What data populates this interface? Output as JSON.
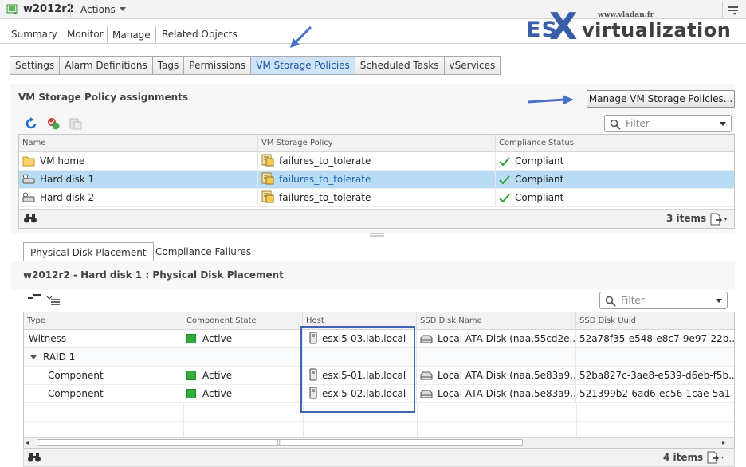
{
  "header": {
    "vm_name": "w2012r2",
    "actions_label": "Actions"
  },
  "logo": {
    "site": "www.vladan.fr",
    "es": "ES",
    "x": "X",
    "rest": "virtualization"
  },
  "main_tabs": [
    "Summary",
    "Monitor",
    "Manage",
    "Related Objects"
  ],
  "sub_tabs": [
    "Settings",
    "Alarm Definitions",
    "Tags",
    "Permissions",
    "VM Storage Policies",
    "Scheduled Tasks",
    "vServices"
  ],
  "assignments": {
    "title": "VM Storage Policy assignments",
    "manage_button": "Manage VM Storage Policies...",
    "filter_placeholder": "Filter",
    "columns": [
      "Name",
      "VM Storage Policy",
      "Compliance Status"
    ],
    "rows": [
      {
        "name": "VM home",
        "policy": "failures_to_tolerate",
        "status": "Compliant"
      },
      {
        "name": "Hard disk 1",
        "policy": "failures_to_tolerate",
        "status": "Compliant"
      },
      {
        "name": "Hard disk 2",
        "policy": "failures_to_tolerate",
        "status": "Compliant"
      }
    ],
    "items_count": "3 items"
  },
  "bottom_tabs": [
    "Physical Disk Placement",
    "Compliance Failures"
  ],
  "placement": {
    "title": "w2012r2 - Hard disk 1 : Physical Disk Placement",
    "filter_placeholder": "Filter",
    "columns": [
      "Type",
      "Component State",
      "Host",
      "SSD Disk Name",
      "SSD Disk Uuid"
    ],
    "rows": [
      {
        "type": "Witness",
        "state": "Active",
        "host": "esxi5-03.lab.local",
        "ssd": "Local ATA Disk (naa.55cd2e...",
        "uuid": "52a78f35-e548-e8c7-9e97-22b..."
      },
      {
        "type": "RAID 1"
      },
      {
        "type": "Component",
        "state": "Active",
        "host": "esxi5-01.lab.local",
        "ssd": "Local ATA Disk (naa.5e83a9...",
        "uuid": "52ba827c-3ae8-e539-d6eb-f5b..."
      },
      {
        "type": "Component",
        "state": "Active",
        "host": "esxi5-02.lab.local",
        "ssd": "Local ATA Disk (naa.5e83a9...",
        "uuid": "521399b2-6ad6-ec56-1cae-5a1..."
      }
    ],
    "items_count": "4 items"
  }
}
